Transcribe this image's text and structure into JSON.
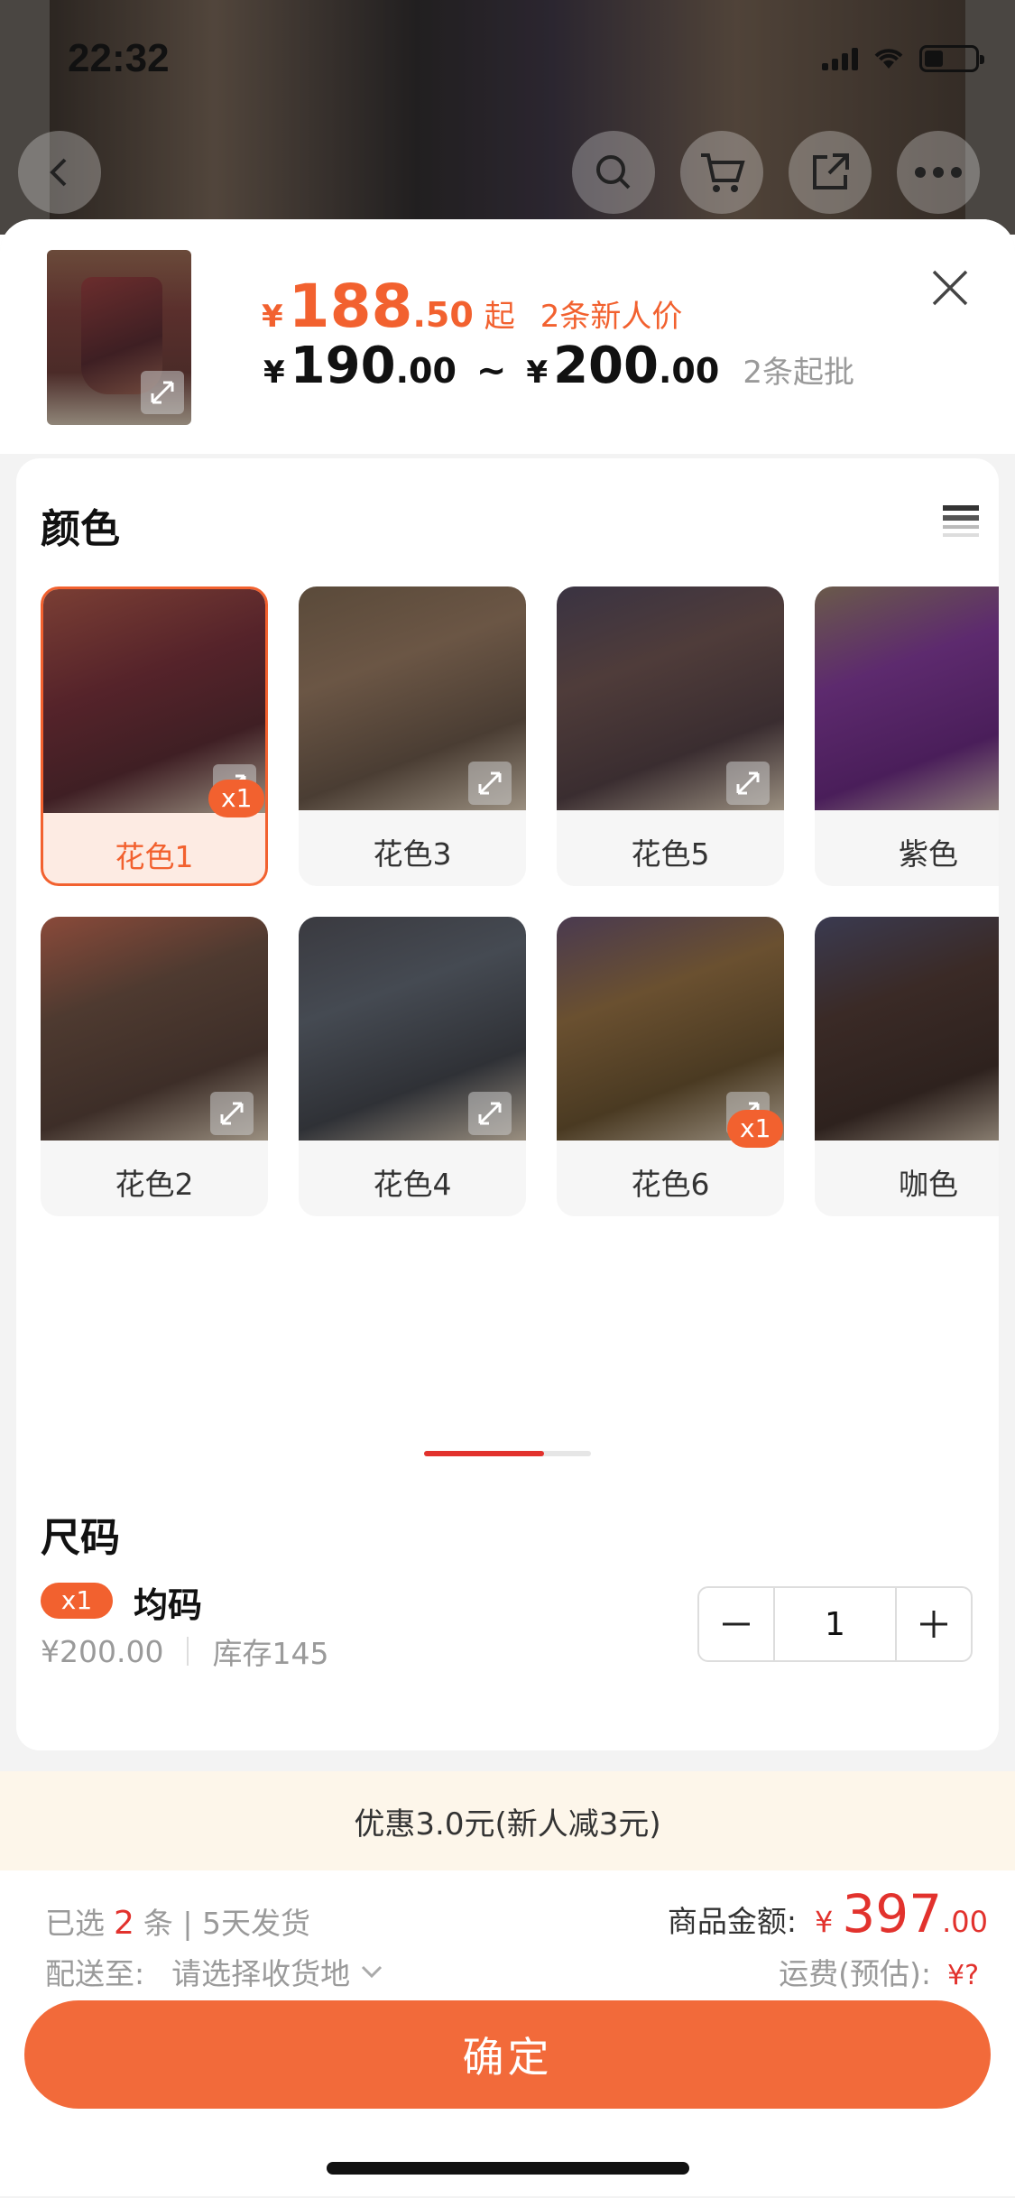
{
  "status_bar": {
    "time": "22:32"
  },
  "header": {
    "new_price_yen": "¥",
    "new_price_int": "188",
    "new_price_dec": ".50",
    "new_price_suffix": "起",
    "new_price_note": "2条新人价",
    "range_yen1": "¥",
    "range_low_int": "190",
    "range_low_dec": ".00",
    "range_sep": "~",
    "range_yen2": "¥",
    "range_high_int": "200",
    "range_high_dec": ".00",
    "min_order_note": "2条起批"
  },
  "color_section": {
    "title": "颜色",
    "swatches": [
      {
        "name": "花色1",
        "badge": "x1"
      },
      {
        "name": "花色3"
      },
      {
        "name": "花色5"
      },
      {
        "name": "紫色"
      },
      {
        "name": "花色2"
      },
      {
        "name": "花色4"
      },
      {
        "name": "花色6",
        "badge": "x1"
      },
      {
        "name": "咖色"
      }
    ]
  },
  "size_section": {
    "title": "尺码",
    "item": {
      "badge": "x1",
      "name": "均码",
      "price": "¥200.00",
      "stock": "库存145",
      "quantity": "1"
    }
  },
  "promo": {
    "text": "优惠3.0元(新人减3元)"
  },
  "footer": {
    "selected_prefix": "已选",
    "selected_count": "2",
    "selected_suffix": "条 | 5天发货",
    "ship_label": "配送至:",
    "ship_value": "请选择收货地",
    "amount_label": "商品金额:",
    "amount_yen": "¥",
    "amount_int": "397",
    "amount_dec": ".00",
    "freight_label": "运费(预估):",
    "freight_value": "¥?",
    "confirm_label": "确定"
  },
  "colors": {
    "accent": "#f2612f",
    "price_red": "#e2322d",
    "promo_bg": "#fdf6ea"
  }
}
